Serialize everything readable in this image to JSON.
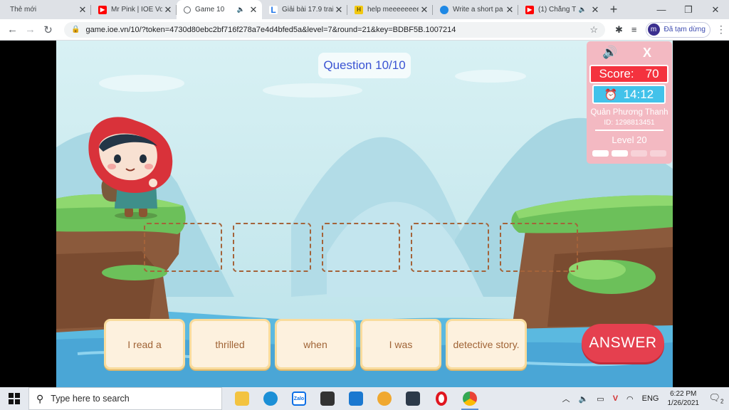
{
  "browser": {
    "tabs": [
      {
        "title": "Thẻ mới",
        "favicon": "",
        "color": ""
      },
      {
        "title": "Mr Pink | IOE Vo",
        "favicon": "youtube-icon",
        "color": "#ff0000"
      },
      {
        "title": "Game 10",
        "favicon": "loading-icon",
        "color": "#5f6368",
        "active": true
      },
      {
        "title": "Giải bài 17.9 trai",
        "favicon": "L",
        "color": "#1a73e8"
      },
      {
        "title": "help meeeeeeeee",
        "favicon": "H",
        "color": "#f2c811"
      },
      {
        "title": "Write a short pa",
        "favicon": "cloud-icon",
        "color": "#1e88e5"
      },
      {
        "title": "(1) Chẳng T",
        "favicon": "youtube-icon",
        "color": "#ff0000"
      }
    ],
    "new_tab": "+",
    "url": "game.ioe.vn/10/?token=4730d80ebc2bf716f278a7e4d4bfed5a&level=7&round=21&key=BDBF5B.1007214",
    "profile_initial": "m",
    "profile_label": "Đã tạm dừng"
  },
  "game": {
    "question": "Question 10/10",
    "word_cards": [
      "I read a",
      "thrilled",
      "when",
      "I was",
      "detective story."
    ],
    "answer_label": "ANSWER",
    "panel": {
      "score_label": "Score:",
      "score_value": "70",
      "timer": "14:12",
      "player_name": "Quản Phương Thanh",
      "player_id": "ID: 1298813451",
      "level": "Level 20",
      "close": "X",
      "progress": {
        "done": 2,
        "total": 4
      }
    }
  },
  "taskbar": {
    "search_placeholder": "Type here to search",
    "language": "ENG",
    "time": "6:22 PM",
    "date": "1/26/2021",
    "notification_count": "2"
  }
}
